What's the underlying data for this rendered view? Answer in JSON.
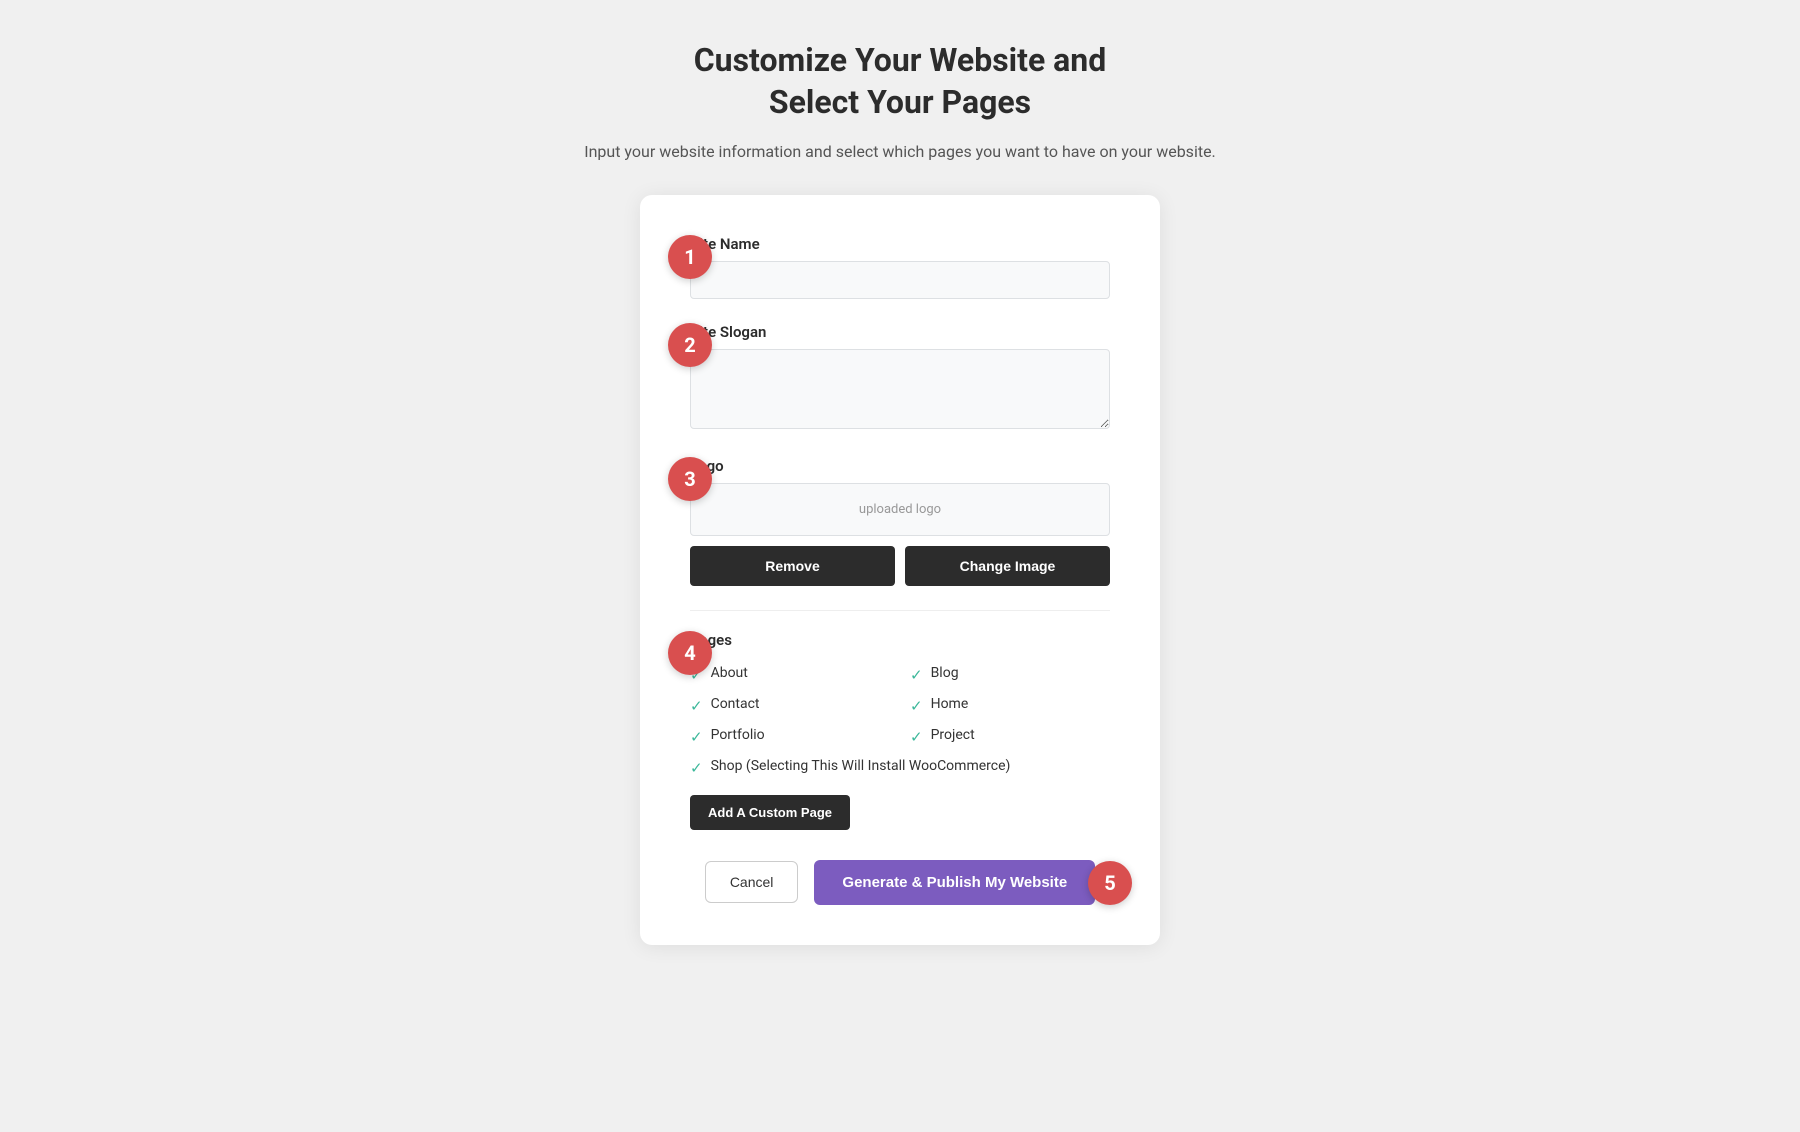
{
  "header": {
    "title_line1": "Customize Your Website and",
    "title_line2": "Select Your Pages",
    "subtitle": "Input your website information and select which pages you want to have on your website."
  },
  "steps": {
    "step1": "1",
    "step2": "2",
    "step3": "3",
    "step4": "4",
    "step5": "5"
  },
  "form": {
    "site_name_label": "Site Name",
    "site_name_placeholder": "",
    "site_slogan_label": "Site Slogan",
    "site_slogan_placeholder": "",
    "logo_label": "Logo",
    "logo_placeholder": "uploaded logo",
    "remove_button": "Remove",
    "change_image_button": "Change Image",
    "pages_label": "Pages",
    "pages": [
      {
        "name": "About",
        "checked": true,
        "col": 1
      },
      {
        "name": "Blog",
        "checked": true,
        "col": 2
      },
      {
        "name": "Contact",
        "checked": true,
        "col": 1
      },
      {
        "name": "Home",
        "checked": true,
        "col": 2
      },
      {
        "name": "Portfolio",
        "checked": true,
        "col": 1
      },
      {
        "name": "Project",
        "checked": true,
        "col": 2
      }
    ],
    "shop_page": {
      "name": "Shop (Selecting This Will Install WooCommerce)",
      "checked": true
    },
    "add_custom_page_button": "Add A Custom Page",
    "cancel_button": "Cancel",
    "publish_button": "Generate & Publish My Website"
  }
}
